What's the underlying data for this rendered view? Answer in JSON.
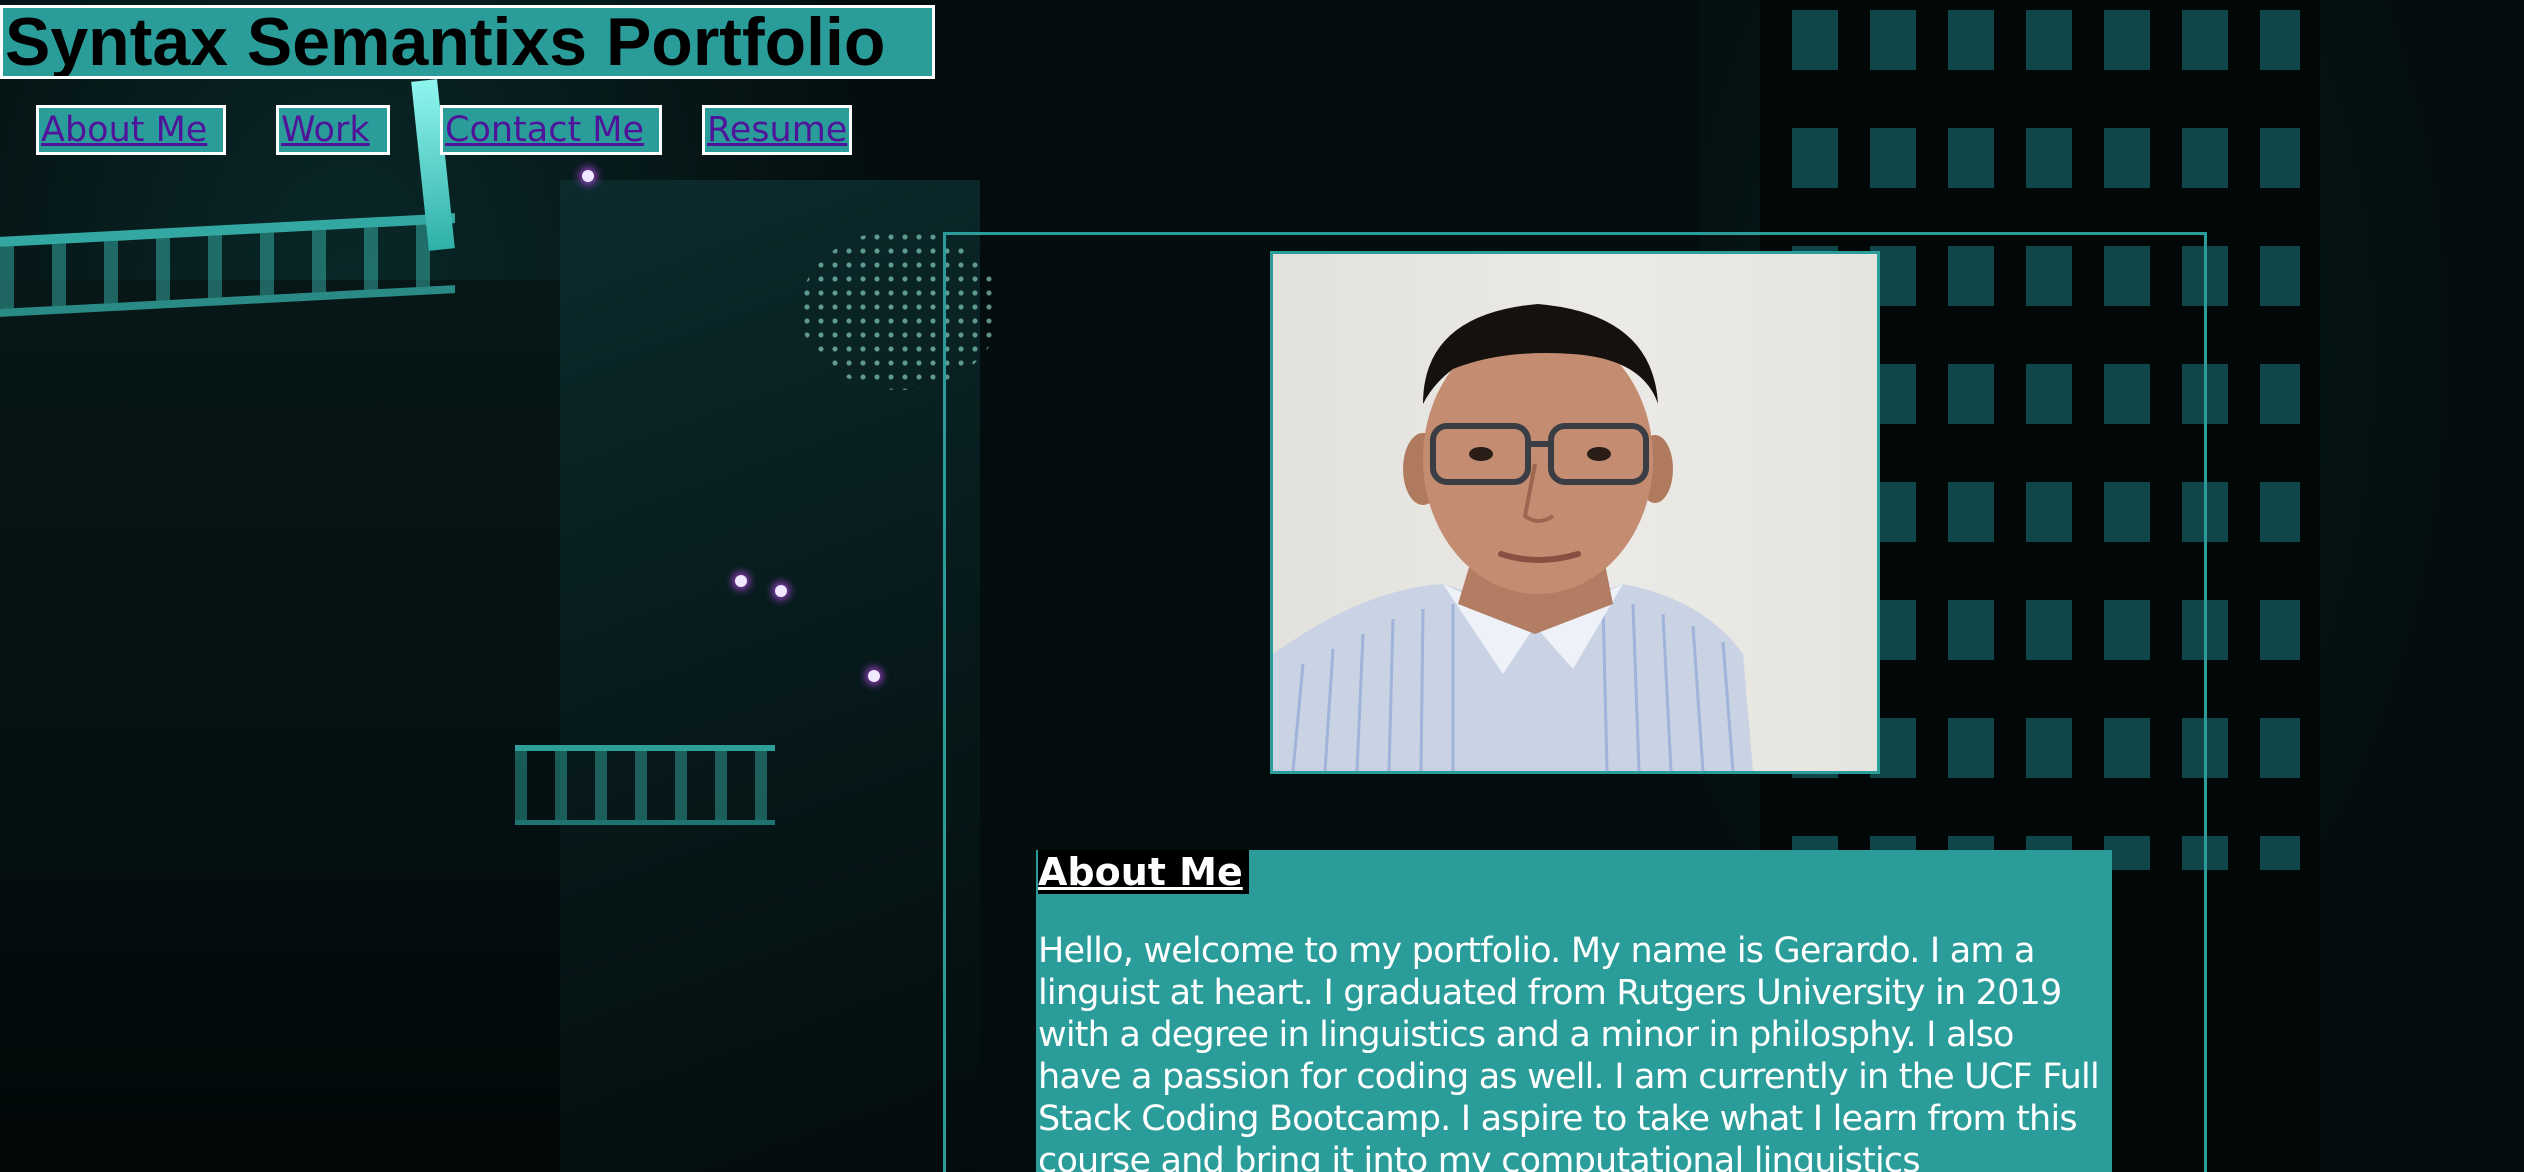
{
  "header": {
    "title": "Syntax Semantixs Portfolio"
  },
  "nav": {
    "items": [
      {
        "label": "About Me"
      },
      {
        "label": "Work"
      },
      {
        "label": "Contact Me"
      },
      {
        "label": "Resume"
      }
    ]
  },
  "about": {
    "heading": "About Me",
    "text": "Hello, welcome to my portfolio. My name is Gerardo. I am a linguist at heart. I graduated from Rutgers University in 2019 with a degree in linguistics and a minor in philosphy. I also have a passion for coding as well. I am currently in the UCF Full Stack Coding Bootcamp. I aspire to take what I learn from this course and bring it into my computational linguistics"
  },
  "colors": {
    "accent": "#2a9d9a",
    "link": "#50149a",
    "border": "#ffffff"
  }
}
